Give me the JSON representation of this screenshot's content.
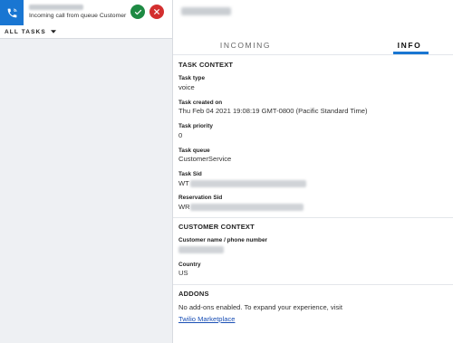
{
  "incoming_call": {
    "subtitle": "Incoming call from queue Customer Se"
  },
  "tasks_filter": {
    "label": "ALL TASKS"
  },
  "tabs": [
    {
      "label": "INCOMING",
      "active": false
    },
    {
      "label": "INFO",
      "active": true
    }
  ],
  "task_context": {
    "title": "TASK CONTEXT",
    "fields": [
      {
        "label": "Task type",
        "value": "voice"
      },
      {
        "label": "Task created on",
        "value": "Thu Feb 04 2021 19:08:19 GMT-0800 (Pacific Standard Time)"
      },
      {
        "label": "Task priority",
        "value": "0"
      },
      {
        "label": "Task queue",
        "value": "CustomerService"
      },
      {
        "label": "Task Sid",
        "value": "WT"
      },
      {
        "label": "Reservation Sid",
        "value": "WR"
      }
    ]
  },
  "customer_context": {
    "title": "CUSTOMER CONTEXT",
    "fields": [
      {
        "label": "Customer name / phone number",
        "value": ""
      },
      {
        "label": "Country",
        "value": "US"
      }
    ]
  },
  "addons": {
    "title": "ADDONS",
    "text": "No add-ons enabled. To expand your experience, visit",
    "link_text": "Twilio Marketplace"
  },
  "colors": {
    "accent": "#1976d2",
    "accept": "#1e8a43",
    "reject": "#d32f2f",
    "link": "#1a4fb5"
  }
}
